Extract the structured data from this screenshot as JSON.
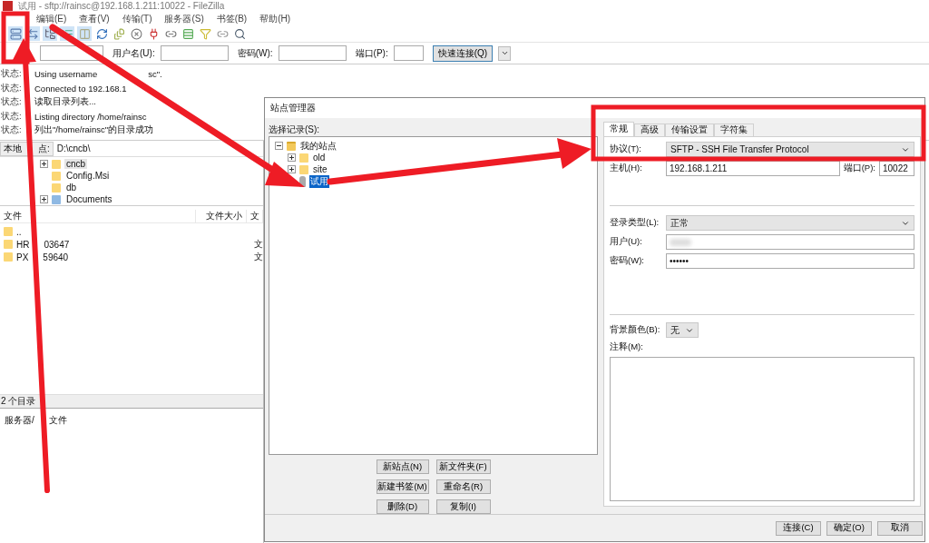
{
  "window": {
    "title": "试用 - sftp://rainsc@192.168.1.211:10022 - FileZilla"
  },
  "menu": [
    "编辑(E)",
    "查看(V)",
    "传输(T)",
    "服务器(S)",
    "书签(B)",
    "帮助(H)"
  ],
  "quickconnect": {
    "fields": [
      {
        "label": "用户名(U):"
      },
      {
        "label": "密码(W):"
      },
      {
        "label": "端口(P):"
      }
    ],
    "button": "快速连接(Q)"
  },
  "log": [
    {
      "label": "状态:",
      "message": "Using username",
      "tail": "sc\"."
    },
    {
      "label": "状态:",
      "message": "Connected to 192.168.1"
    },
    {
      "label": "状态:",
      "message": "读取目录列表..."
    },
    {
      "label": "状态:",
      "message": "Listing directory /home/rainsc"
    },
    {
      "label": "状态:",
      "message": "列出\"/home/rainsc\"的目录成功"
    }
  ],
  "local": {
    "label": "本地",
    "label_tail": "点:",
    "path": "D:\\cncb\\",
    "tree": [
      {
        "name": "cncb",
        "kind": "folder",
        "expandable": true,
        "selected": true
      },
      {
        "name": "Config.Msi",
        "kind": "folder",
        "expandable": false,
        "selected": false
      },
      {
        "name": "db",
        "kind": "folder",
        "expandable": false,
        "selected": false
      },
      {
        "name": "Documents",
        "kind": "library",
        "expandable": true,
        "selected": false
      }
    ],
    "columns": [
      "文件",
      "文件大小",
      "文"
    ],
    "rows": [
      {
        "name": ".."
      },
      {
        "name": "HR",
        "name_tail": "03647",
        "type": "文"
      },
      {
        "name": "PX",
        "name_tail": "59640",
        "type": "文"
      }
    ],
    "status": "2 个目录"
  },
  "queue": {
    "label": "服务器/",
    "label_tail": "文件"
  },
  "site_manager": {
    "title": "站点管理器",
    "tree_label": "选择记录(S):",
    "tree": [
      {
        "name": "我的站点",
        "kind": "root",
        "expanded": true,
        "selected": false,
        "children": [
          {
            "name": "old",
            "kind": "folder",
            "expanded": false,
            "selected": false
          },
          {
            "name": "site",
            "kind": "folder",
            "expanded": false,
            "selected": false
          },
          {
            "name": "试用",
            "kind": "server",
            "selected": true
          }
        ]
      }
    ],
    "tree_buttons": [
      "新站点(N)",
      "新文件夹(F)",
      "新建书签(M)",
      "重命名(R)",
      "删除(D)",
      "复制(I)"
    ],
    "tabs": [
      {
        "label": "常规",
        "selected": true
      },
      {
        "label": "高级",
        "selected": false
      },
      {
        "label": "传输设置",
        "selected": false
      },
      {
        "label": "字符集",
        "selected": false
      }
    ],
    "protocol": {
      "label": "协议(T):",
      "value": "SFTP - SSH File Transfer Protocol"
    },
    "host": {
      "label": "主机(H):",
      "value": "192.168.1.211"
    },
    "port": {
      "label": "端口(P):",
      "value": "10022"
    },
    "logon_type": {
      "label": "登录类型(L):",
      "value": "正常"
    },
    "user": {
      "label": "用户(U):",
      "blurred": true
    },
    "password": {
      "label": "密码(W):",
      "value": "••••••"
    },
    "background": {
      "label": "背景颜色(B):",
      "value": "无"
    },
    "comments": {
      "label": "注释(M):"
    },
    "buttons": [
      "连接(C)",
      "确定(O)",
      "取消"
    ]
  }
}
